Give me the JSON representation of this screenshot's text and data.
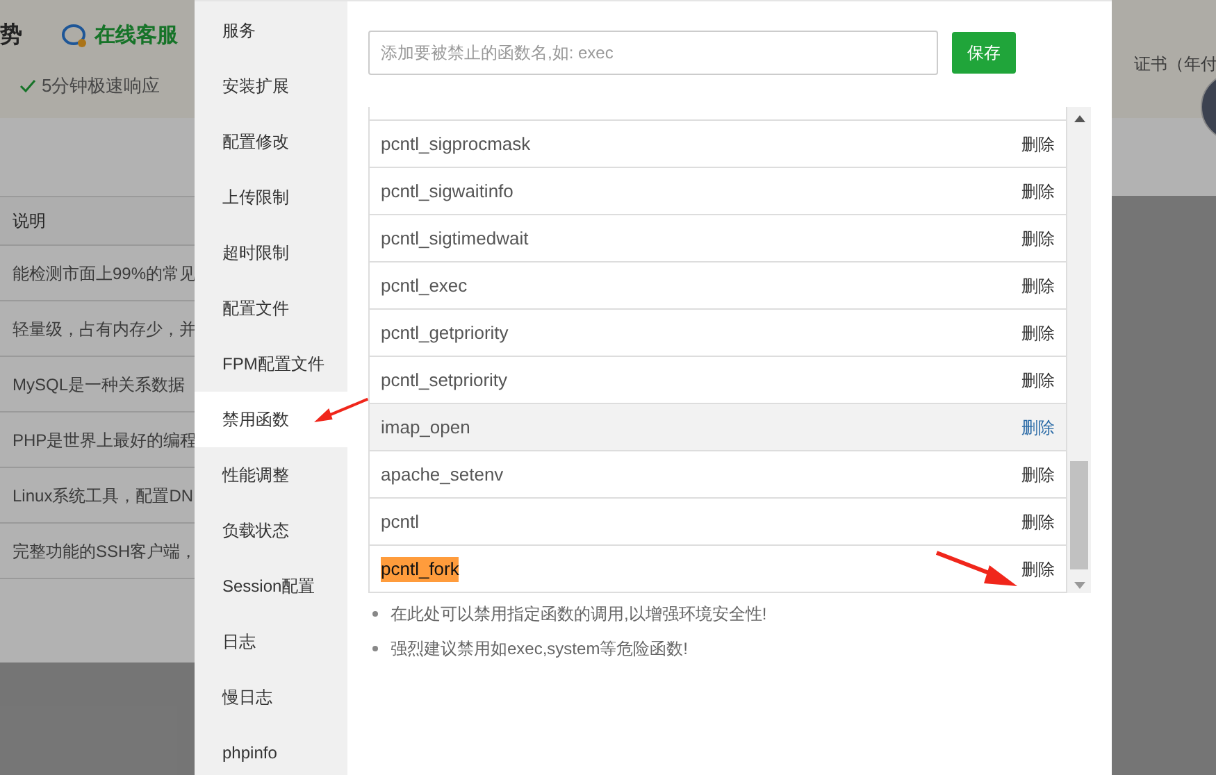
{
  "background_page": {
    "header": {
      "title": "势",
      "support": "在线客服",
      "feature": "5分钟极速响应",
      "right_text": "证书（年付"
    },
    "table": {
      "column": "说明",
      "rows": [
        "能检测市面上99%的常见",
        "轻量级，占有内存少，并",
        "MySQL是一种关系数据",
        "PHP是世界上最好的编程",
        "Linux系统工具，配置DN",
        "完整功能的SSH客户端，"
      ]
    }
  },
  "dialog": {
    "sidebar": {
      "items": [
        {
          "label": "服务",
          "selected": false
        },
        {
          "label": "安装扩展",
          "selected": false
        },
        {
          "label": "配置修改",
          "selected": false
        },
        {
          "label": "上传限制",
          "selected": false
        },
        {
          "label": "超时限制",
          "selected": false
        },
        {
          "label": "配置文件",
          "selected": false
        },
        {
          "label": "FPM配置文件",
          "selected": false
        },
        {
          "label": "禁用函数",
          "selected": true
        },
        {
          "label": "性能调整",
          "selected": false
        },
        {
          "label": "负载状态",
          "selected": false
        },
        {
          "label": "Session配置",
          "selected": false
        },
        {
          "label": "日志",
          "selected": false
        },
        {
          "label": "慢日志",
          "selected": false
        },
        {
          "label": "phpinfo",
          "selected": false
        }
      ]
    },
    "function_input": {
      "placeholder": "添加要被禁止的函数名,如: exec"
    },
    "save_button": "保存",
    "functions": [
      {
        "name": "pcntl_sigprocmask",
        "action": "删除",
        "hovered": false,
        "highlighted": false
      },
      {
        "name": "pcntl_sigwaitinfo",
        "action": "删除",
        "hovered": false,
        "highlighted": false
      },
      {
        "name": "pcntl_sigtimedwait",
        "action": "删除",
        "hovered": false,
        "highlighted": false
      },
      {
        "name": "pcntl_exec",
        "action": "删除",
        "hovered": false,
        "highlighted": false
      },
      {
        "name": "pcntl_getpriority",
        "action": "删除",
        "hovered": false,
        "highlighted": false
      },
      {
        "name": "pcntl_setpriority",
        "action": "删除",
        "hovered": false,
        "highlighted": false
      },
      {
        "name": "imap_open",
        "action": "删除",
        "hovered": true,
        "highlighted": false
      },
      {
        "name": "apache_setenv",
        "action": "删除",
        "hovered": false,
        "highlighted": false
      },
      {
        "name": "pcntl",
        "action": "删除",
        "hovered": false,
        "highlighted": false
      },
      {
        "name": "pcntl_fork",
        "action": "删除",
        "hovered": false,
        "highlighted": true
      }
    ],
    "notes": [
      "在此处可以禁用指定函数的调用,以增强环境安全性!",
      "强烈建议禁用如exec,system等危险函数!"
    ]
  }
}
